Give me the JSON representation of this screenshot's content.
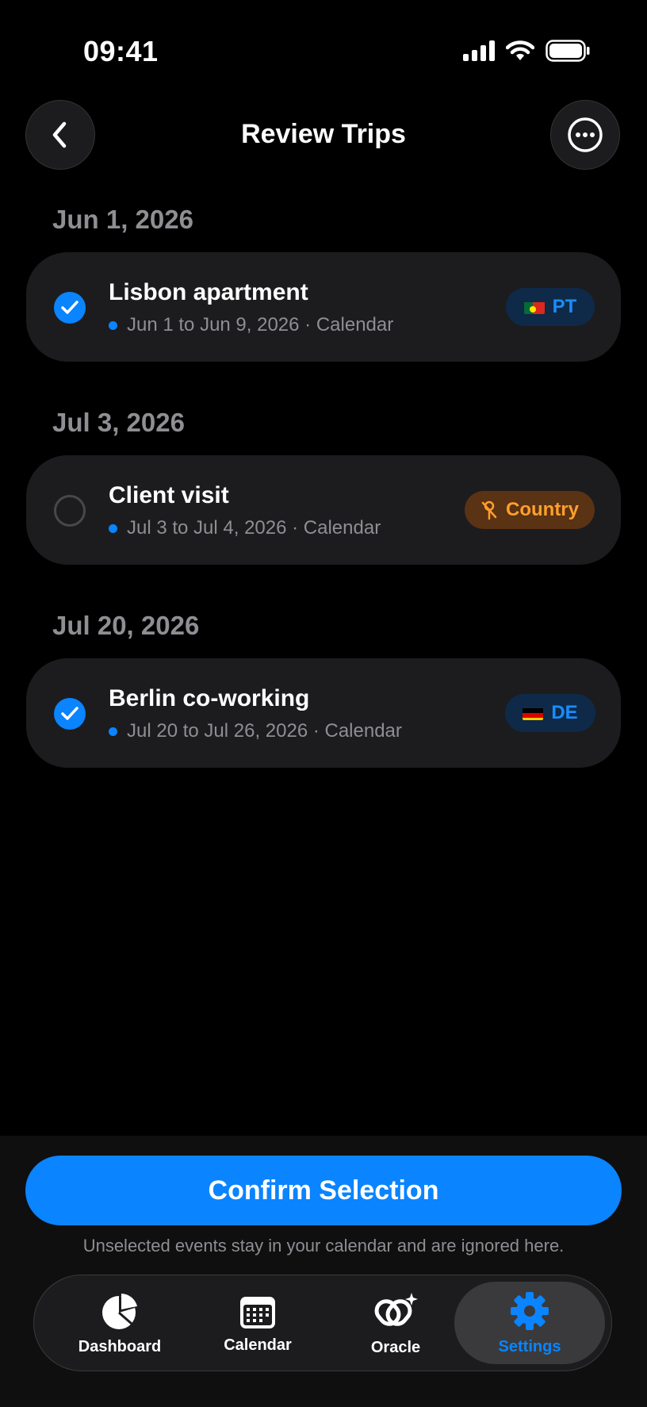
{
  "status": {
    "time": "09:41"
  },
  "header": {
    "title": "Review Trips"
  },
  "sections": [
    {
      "date": "Jun 1, 2026",
      "trip": {
        "title": "Lisbon apartment",
        "subtitle": "Jun 1 to Jun 9, 2026 · Calendar",
        "selected": true,
        "badge": "PT",
        "badge_type": "country-code"
      }
    },
    {
      "date": "Jul 3, 2026",
      "trip": {
        "title": "Client visit",
        "subtitle": "Jul 3 to Jul 4, 2026 · Calendar",
        "selected": false,
        "badge": "Country",
        "badge_type": "needs-country"
      }
    },
    {
      "date": "Jul 20, 2026",
      "trip": {
        "title": "Berlin co-working",
        "subtitle": "Jul 20 to Jul 26, 2026 · Calendar",
        "selected": true,
        "badge": "DE",
        "badge_type": "country-code"
      }
    }
  ],
  "footer": {
    "confirm_label": "Confirm Selection",
    "hint": "Unselected events stay in your calendar and are ignored here."
  },
  "tabs": [
    {
      "label": "Dashboard",
      "icon": "pie-chart-icon",
      "active": false
    },
    {
      "label": "Calendar",
      "icon": "calendar-icon",
      "active": false
    },
    {
      "label": "Oracle",
      "icon": "oracle-link-icon",
      "active": false
    },
    {
      "label": "Settings",
      "icon": "gear-icon",
      "active": true
    }
  ],
  "colors": {
    "accent": "#0a84ff",
    "background": "#000000",
    "card": "#1c1c1e",
    "warning": "#ff9f2e"
  }
}
